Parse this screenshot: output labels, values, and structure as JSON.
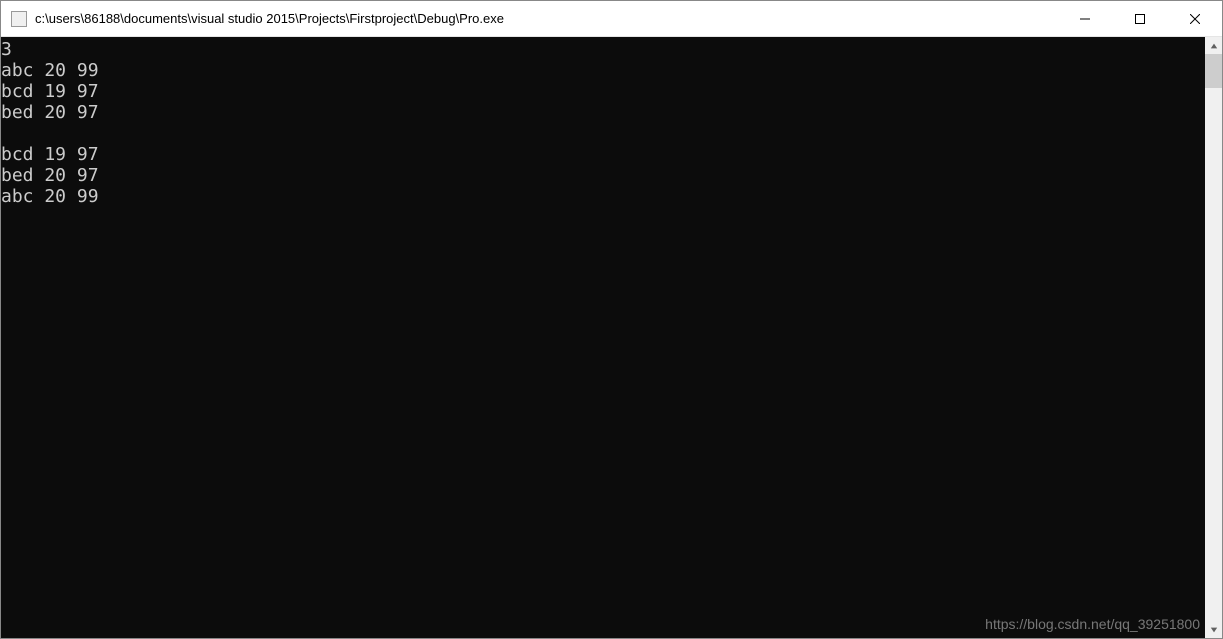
{
  "window": {
    "title": "c:\\users\\86188\\documents\\visual studio 2015\\Projects\\Firstproject\\Debug\\Pro.exe"
  },
  "console": {
    "lines": [
      "3",
      "abc 20 99",
      "bcd 19 97",
      "bed 20 97",
      "",
      "bcd 19 97",
      "bed 20 97",
      "abc 20 99"
    ]
  },
  "watermark": "https://blog.csdn.net/qq_39251800"
}
